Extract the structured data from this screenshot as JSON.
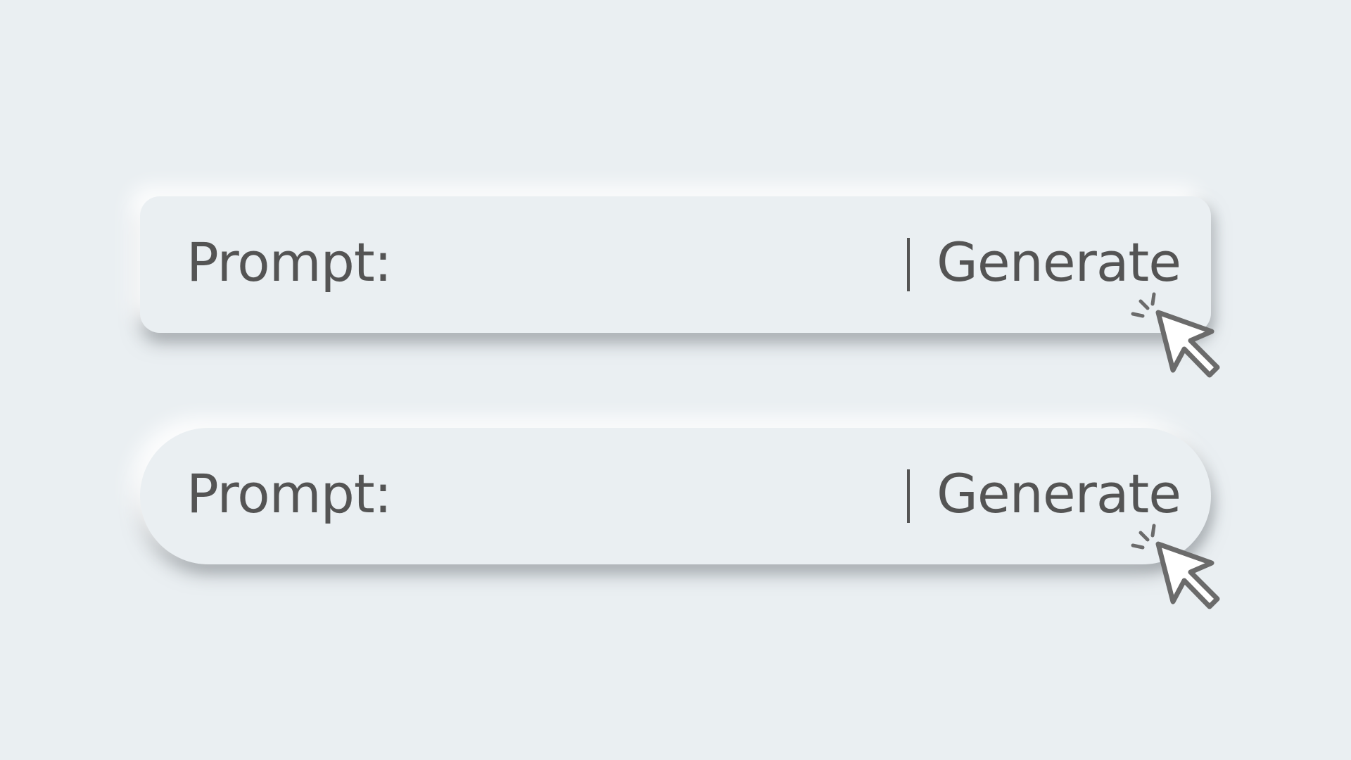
{
  "bars": [
    {
      "label": "Prompt:",
      "input_placeholder": "___",
      "button_label": "Generate",
      "cursor_icon": "pointer-click-icon"
    },
    {
      "label": "Prompt:",
      "input_placeholder": "___",
      "button_label": "Generate",
      "cursor_icon": "pointer-click-icon"
    }
  ],
  "colors": {
    "background": "#eaeff2",
    "text": "#545454",
    "cursor_outline": "#6b6b6b",
    "cursor_fill": "#ffffff"
  }
}
